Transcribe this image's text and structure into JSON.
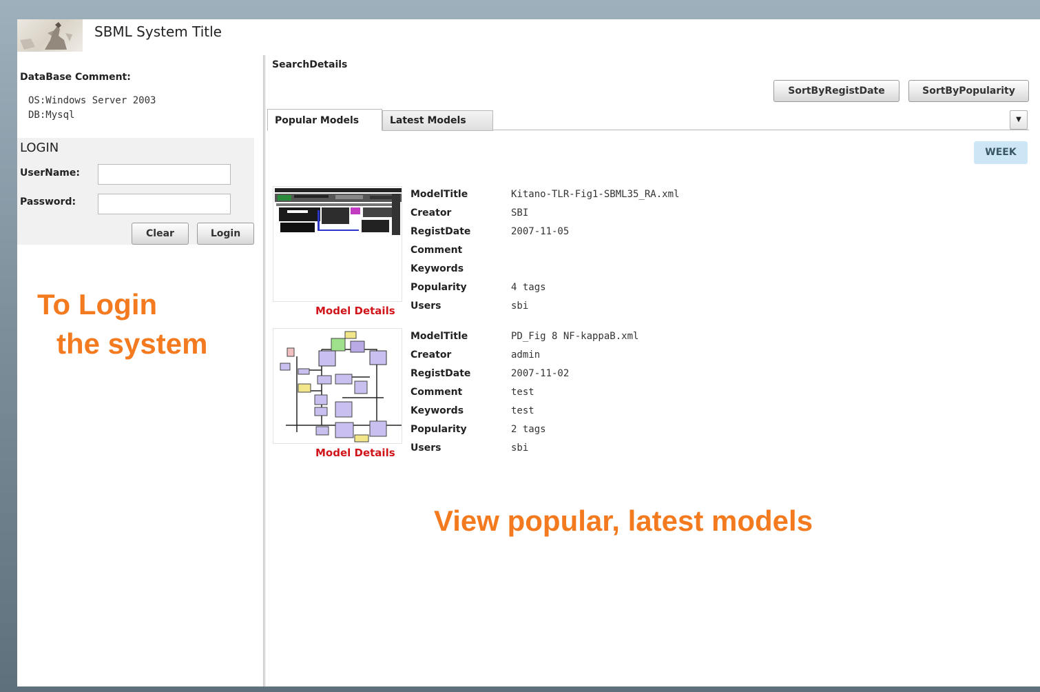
{
  "header": {
    "app_title": "SBML System Title",
    "logo_icon": "engraving-logo"
  },
  "database": {
    "label": "DataBase Comment:",
    "lines": [
      "OS:Windows Server 2003",
      "DB:Mysql"
    ]
  },
  "login": {
    "title": "LOGIN",
    "username_label": "UserName:",
    "username_value": "",
    "password_label": "Password:",
    "password_value": "",
    "clear_label": "Clear",
    "login_label": "Login"
  },
  "annotations": {
    "login_note_line1": "To Login",
    "login_note_line2": "the system",
    "models_note": "View popular, latest models"
  },
  "search": {
    "title": "SearchDetails",
    "sort_by_regist_date": "SortByRegistDate",
    "sort_by_popularity": "SortByPopularity"
  },
  "tabs": [
    {
      "label": "Popular Models",
      "active": true
    },
    {
      "label": "Latest Models",
      "active": false
    }
  ],
  "dropdown_icon": "chevron-down-icon",
  "period_badge": "WEEK",
  "field_labels": {
    "title": "ModelTitle",
    "creator": "Creator",
    "regist_date": "RegistDate",
    "comment": "Comment",
    "keywords": "Keywords",
    "popularity": "Popularity",
    "users": "Users"
  },
  "models": [
    {
      "title": "Kitano-TLR-Fig1-SBML35_RA.xml",
      "creator": "SBI",
      "regist_date": "2007-11-05",
      "comment": "",
      "keywords": "",
      "popularity": "4 tags",
      "users": "sbi",
      "details_link": "Model Details"
    },
    {
      "title": "PD_Fig 8 NF-kappaB.xml",
      "creator": "admin",
      "regist_date": "2007-11-02",
      "comment": "test",
      "keywords": "test",
      "popularity": "2 tags",
      "users": "sbi",
      "details_link": "Model Details"
    }
  ],
  "colors": {
    "annotation": "#f47a1f",
    "details_link": "#d0141a",
    "week_badge": "#cde6f5"
  }
}
